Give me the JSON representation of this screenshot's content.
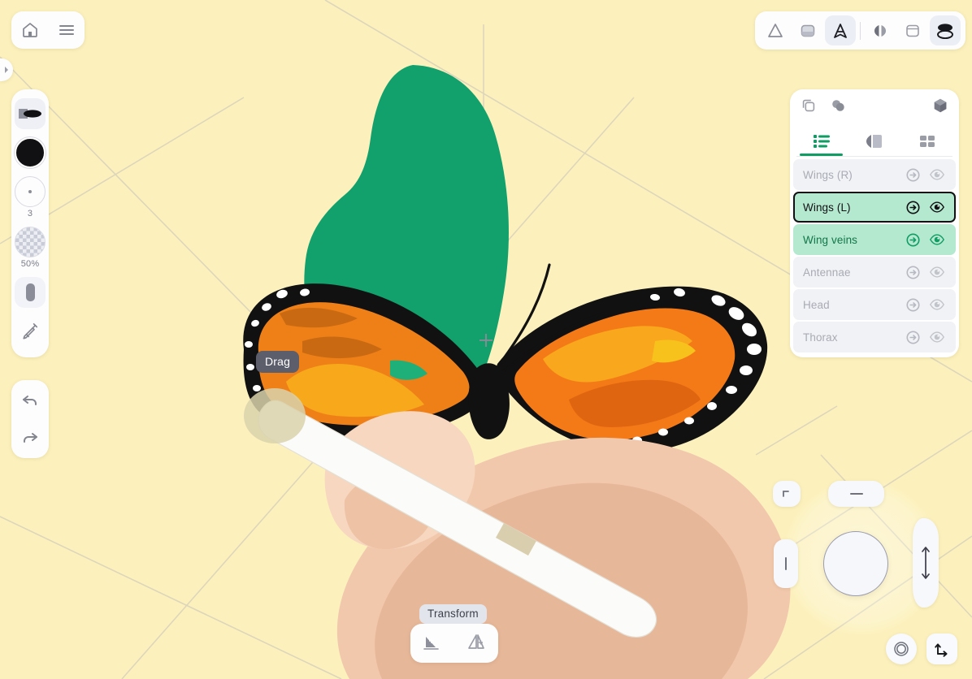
{
  "app": {
    "canvas_bg": "#fcf1bd",
    "accent_green": "#0f9d63",
    "shape_green": "#12a06d",
    "guide_color": "#ddd6ba"
  },
  "topleft": {
    "home_label": "Home",
    "menu_label": "Menu",
    "edge_tab_label": "Expand panel"
  },
  "toptools": [
    {
      "name": "shape-triangle-tool",
      "label": "Triangle shape",
      "active": false
    },
    {
      "name": "shape-fill-tool",
      "label": "Filled shape",
      "active": false
    },
    {
      "name": "pointer-a-tool",
      "label": "Pointer",
      "active": true
    },
    {
      "name": "symmetry-tool",
      "label": "Symmetry",
      "active": false
    },
    {
      "name": "frame-tool",
      "label": "Frame",
      "active": false
    },
    {
      "name": "layers-tool",
      "label": "Layers",
      "active": true
    }
  ],
  "left_rail": {
    "brush": {
      "label": "Brush",
      "selected": true
    },
    "color": {
      "label": "Color",
      "value": "#111114"
    },
    "size": {
      "label": "Brush size",
      "value": "3"
    },
    "opacity": {
      "label": "Opacity",
      "value": "50%"
    },
    "eraser": {
      "label": "Eraser"
    },
    "eyedropper": {
      "label": "Eyedropper"
    },
    "undo": {
      "label": "Undo"
    },
    "redo": {
      "label": "Redo"
    }
  },
  "layers_panel": {
    "header": {
      "duplicate_label": "Duplicate",
      "merge_label": "Merge",
      "cube_label": "3D view"
    },
    "tabs": [
      {
        "name": "tab-layers",
        "label": "Layers",
        "active": true
      },
      {
        "name": "tab-shapes",
        "label": "Shapes",
        "active": false
      },
      {
        "name": "tab-grid",
        "label": "Grid",
        "active": false
      }
    ],
    "rows": [
      {
        "label": "Wings (R)",
        "state": "dim",
        "visible": false,
        "selected": false
      },
      {
        "label": "Wings (L)",
        "state": "selected",
        "visible": true,
        "selected": true
      },
      {
        "label": "Wing veins",
        "state": "green",
        "visible": true,
        "selected": false
      },
      {
        "label": "Antennae",
        "state": "dim",
        "visible": false,
        "selected": false
      },
      {
        "label": "Head",
        "state": "dim",
        "visible": false,
        "selected": false
      },
      {
        "label": "Thorax",
        "state": "dim",
        "visible": false,
        "selected": false
      }
    ],
    "row_action_label": "Enter layer",
    "row_visibility_label": "Toggle visibility"
  },
  "tooltips": {
    "drag": "Drag",
    "transform": "Transform"
  },
  "transform_bar": {
    "flip_vertical_label": "Flip vertical",
    "flip_horizontal_label": "Flip horizontal"
  },
  "puck": {
    "center_label": "Radial control",
    "corner_label": "Corner snap",
    "dash_label": "Horizontal guide",
    "vline_label": "Vertical guide",
    "arc_label": "Vertical scale",
    "record_label": "Record",
    "axis_label": "Axis transform"
  }
}
